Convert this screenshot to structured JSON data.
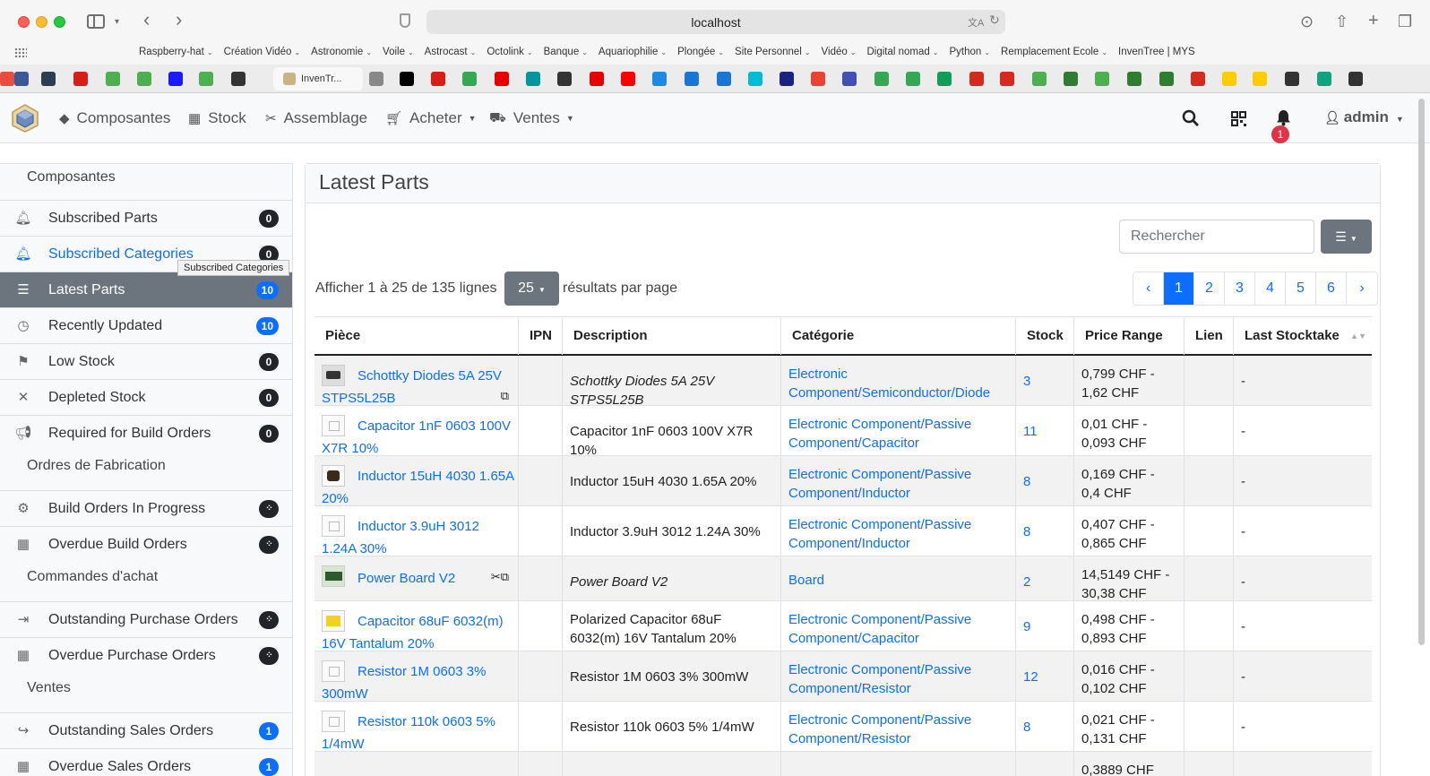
{
  "browser": {
    "url": "localhost",
    "bookmarks": [
      "Raspberry-hat",
      "Création Vidéo",
      "Astronomie",
      "Voile",
      "Astrocast",
      "Octolink",
      "Banque",
      "Aquariophilie",
      "Plongée",
      "Site Personnel",
      "Vidéo",
      "Digital nomad",
      "Python",
      "Remplacement Ecole",
      "InvenTree | MYS"
    ],
    "bookmark_has_menu": [
      true,
      true,
      true,
      true,
      true,
      true,
      true,
      true,
      true,
      true,
      true,
      true,
      true,
      true,
      false
    ],
    "active_tab": "InvenTr...",
    "favicon_colors": [
      "#e74c3c",
      "#3b5998",
      "#2c3e50",
      "#d91e18",
      "#4caf50",
      "#4caf50",
      "#1a1aff",
      "#4caf50",
      "#333333",
      "#888888",
      "#000000",
      "#d91e18",
      "#34a853",
      "#e60000",
      "#00979d",
      "#333333",
      "#e60000",
      "#ff0000",
      "#1e88e5",
      "#1976d2",
      "#1976d2",
      "#00bcd4",
      "#1a237e",
      "#ea4335",
      "#3f51b5",
      "#34a853",
      "#34a853",
      "#0f9d58",
      "#d52b1e",
      "#d52b1e",
      "#4caf50",
      "#2e7d32",
      "#4caf50",
      "#2e7d32",
      "#2e7d32",
      "#d52b1e",
      "#ffcc00",
      "#ffcc00",
      "#333333",
      "#10a37f",
      "#333333"
    ]
  },
  "navbar": {
    "items": [
      {
        "label": "Composantes",
        "icon": "shapes-icon",
        "dropdown": false
      },
      {
        "label": "Stock",
        "icon": "boxes-icon",
        "dropdown": false
      },
      {
        "label": "Assemblage",
        "icon": "tools-icon",
        "dropdown": false
      },
      {
        "label": "Acheter",
        "icon": "cart-icon",
        "dropdown": true
      },
      {
        "label": "Ventes",
        "icon": "truck-icon",
        "dropdown": true
      }
    ],
    "notifications_count": "1",
    "user": "admin"
  },
  "sidebar": {
    "groups": [
      {
        "header": "Composantes",
        "items": [
          {
            "label": "Subscribed Parts",
            "icon": "bell-icon",
            "badge": "0",
            "badge_style": "dark",
            "state": ""
          },
          {
            "label": "Subscribed Categories",
            "icon": "bell-icon",
            "badge": "0",
            "badge_style": "dark",
            "state": "link"
          },
          {
            "label": "Latest Parts",
            "icon": "list-icon",
            "badge": "10",
            "badge_style": "blue",
            "state": "active"
          },
          {
            "label": "Recently Updated",
            "icon": "clock-icon",
            "badge": "10",
            "badge_style": "blue",
            "state": ""
          },
          {
            "label": "Low Stock",
            "icon": "flag-icon",
            "badge": "0",
            "badge_style": "dark",
            "state": ""
          },
          {
            "label": "Depleted Stock",
            "icon": "times-icon",
            "badge": "0",
            "badge_style": "dark",
            "state": ""
          },
          {
            "label": "Required for Build Orders",
            "icon": "bullhorn-icon",
            "badge": "0",
            "badge_style": "dark",
            "state": ""
          }
        ]
      },
      {
        "header": "Ordres de Fabrication",
        "items": [
          {
            "label": "Build Orders In Progress",
            "icon": "cogs-icon",
            "badge": "",
            "badge_style": "spin",
            "state": ""
          },
          {
            "label": "Overdue Build Orders",
            "icon": "calendar-icon",
            "badge": "",
            "badge_style": "spin",
            "state": ""
          }
        ]
      },
      {
        "header": "Commandes d'achat",
        "items": [
          {
            "label": "Outstanding Purchase Orders",
            "icon": "sign-in-icon",
            "badge": "",
            "badge_style": "spin",
            "state": ""
          },
          {
            "label": "Overdue Purchase Orders",
            "icon": "calendar-icon",
            "badge": "",
            "badge_style": "spin",
            "state": ""
          }
        ]
      },
      {
        "header": "Ventes",
        "items": [
          {
            "label": "Outstanding Sales Orders",
            "icon": "sign-out-icon",
            "badge": "1",
            "badge_style": "blue",
            "state": ""
          },
          {
            "label": "Overdue Sales Orders",
            "icon": "calendar-icon",
            "badge": "1",
            "badge_style": "blue",
            "state": ""
          }
        ]
      }
    ],
    "tooltip": "Subscribed Categories"
  },
  "main": {
    "title": "Latest Parts",
    "search_placeholder": "Rechercher",
    "pager_prefix": "Afficher 1 à 25 de 135 lignes",
    "page_size": "25",
    "pager_suffix": "résultats par page",
    "pages": [
      "‹",
      "1",
      "2",
      "3",
      "4",
      "5",
      "6",
      "›"
    ],
    "active_page": "1",
    "columns": [
      "Pièce",
      "IPN",
      "Description",
      "Catégorie",
      "Stock",
      "Price Range",
      "Lien",
      "Last Stocktake"
    ],
    "rows": [
      {
        "thumb": "img1",
        "part": "Schottky Diodes 5A 25V STPS5L25B",
        "ipn": "",
        "description": "Schottky Diodes 5A 25V STPS5L25B",
        "desc_italic": true,
        "category": "Electronic Component/Semiconductor/Diode",
        "stock": "3",
        "price": "0,799 CHF - 1,62 CHF",
        "link": "",
        "stocktake": "-",
        "icons": "⧉"
      },
      {
        "thumb": "empty",
        "part": "Capacitor 1nF 0603 100V X7R 10%",
        "ipn": "",
        "description": "Capacitor 1nF 0603 100V X7R 10%",
        "desc_italic": false,
        "category": "Electronic Component/Passive Component/Capacitor",
        "stock": "11",
        "price": "0,01 CHF - 0,093 CHF",
        "link": "",
        "stocktake": "-",
        "icons": ""
      },
      {
        "thumb": "img2",
        "part": "Inductor 15uH 4030 1.65A 20%",
        "ipn": "",
        "description": "Inductor 15uH 4030 1.65A 20%",
        "desc_italic": false,
        "category": "Electronic Component/Passive Component/Inductor",
        "stock": "8",
        "price": "0,169 CHF - 0,4 CHF",
        "link": "",
        "stocktake": "-",
        "icons": ""
      },
      {
        "thumb": "empty",
        "part": "Inductor 3.9uH 3012 1.24A 30%",
        "ipn": "",
        "description": "Inductor 3.9uH 3012 1.24A 30%",
        "desc_italic": false,
        "category": "Electronic Component/Passive Component/Inductor",
        "stock": "8",
        "price": "0,407 CHF - 0,865 CHF",
        "link": "",
        "stocktake": "-",
        "icons": ""
      },
      {
        "thumb": "img3",
        "part": "Power Board V2",
        "ipn": "",
        "description": "Power Board V2",
        "desc_italic": true,
        "category": "Board",
        "stock": "2",
        "price": "14,5149 CHF - 30,38 CHF",
        "link": "",
        "stocktake": "-",
        "icons": "✂⧉"
      },
      {
        "thumb": "img4",
        "part": "Capacitor 68uF 6032(m) 16V Tantalum 20%",
        "ipn": "",
        "description": "Polarized Capacitor 68uF 6032(m) 16V Tantalum 20%",
        "desc_italic": false,
        "category": "Electronic Component/Passive Component/Capacitor",
        "stock": "9",
        "price": "0,498 CHF - 0,893 CHF",
        "link": "",
        "stocktake": "-",
        "icons": ""
      },
      {
        "thumb": "empty",
        "part": "Resistor 1M 0603 3% 300mW",
        "ipn": "",
        "description": "Resistor 1M 0603 3% 300mW",
        "desc_italic": false,
        "category": "Electronic Component/Passive Component/Resistor",
        "stock": "12",
        "price": "0,016 CHF - 0,102 CHF",
        "link": "",
        "stocktake": "-",
        "icons": ""
      },
      {
        "thumb": "empty",
        "part": "Resistor 110k 0603 5% 1/4mW",
        "ipn": "",
        "description": "Resistor 110k 0603 5% 1/4mW",
        "desc_italic": false,
        "category": "Electronic Component/Passive Component/Resistor",
        "stock": "8",
        "price": "0,021 CHF - 0,131 CHF",
        "link": "",
        "stocktake": "-",
        "icons": ""
      },
      {
        "thumb": "empty",
        "part": "",
        "ipn": "",
        "description": "",
        "desc_italic": false,
        "category": "",
        "stock": "",
        "price": "0,3889 CHF",
        "link": "",
        "stocktake": "",
        "icons": ""
      }
    ]
  }
}
